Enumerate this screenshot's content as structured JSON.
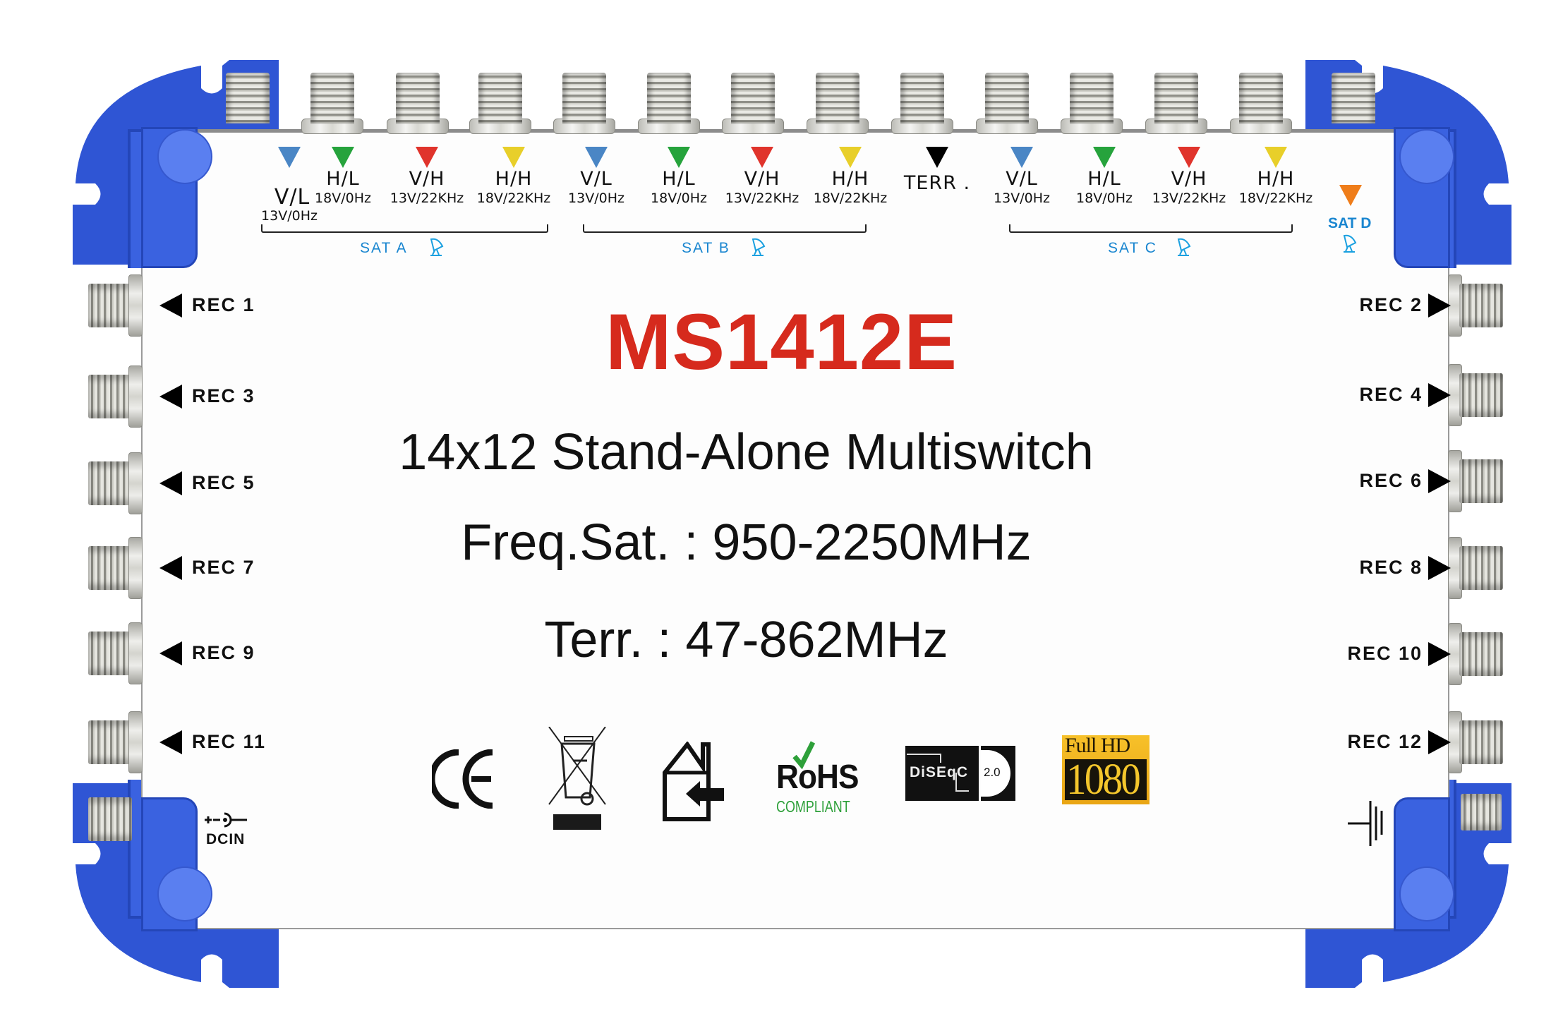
{
  "product": {
    "model": "MS1412E",
    "description": "14x12 Stand-Alone Multiswitch",
    "freq_sat": "Freq.Sat. : 950-2250MHz",
    "freq_terr": "Terr. : 47-862MHz",
    "body_color": "#2f55d4",
    "model_color": "#d62a1d"
  },
  "inputs": [
    {
      "pol": "V/L",
      "volt": "13V/0Hz",
      "color": "#4a86c5"
    },
    {
      "pol": "H/L",
      "volt": "18V/0Hz",
      "color": "#26a33c"
    },
    {
      "pol": "V/H",
      "volt": "13V/22KHz",
      "color": "#e0342c"
    },
    {
      "pol": "H/H",
      "volt": "18V/22KHz",
      "color": "#e8cf2a"
    },
    {
      "pol": "V/L",
      "volt": "13V/0Hz",
      "color": "#4a86c5"
    },
    {
      "pol": "H/L",
      "volt": "18V/0Hz",
      "color": "#26a33c"
    },
    {
      "pol": "V/H",
      "volt": "13V/22KHz",
      "color": "#e0342c"
    },
    {
      "pol": "H/H",
      "volt": "18V/22KHz",
      "color": "#e8cf2a"
    },
    {
      "pol": "TERR .",
      "volt": "",
      "color": "#000000"
    },
    {
      "pol": "V/L",
      "volt": "13V/0Hz",
      "color": "#4a86c5"
    },
    {
      "pol": "H/L",
      "volt": "18V/0Hz",
      "color": "#26a33c"
    },
    {
      "pol": "V/H",
      "volt": "13V/22KHz",
      "color": "#e0342c"
    },
    {
      "pol": "H/H",
      "volt": "18V/22KHz",
      "color": "#e8cf2a"
    }
  ],
  "sat_d": {
    "label": "SAT D",
    "color": "#ef7d1a"
  },
  "sat_groups": [
    {
      "label": "SAT A"
    },
    {
      "label": "SAT B"
    },
    {
      "label": "SAT C"
    }
  ],
  "sat_label_color": "#1a86d0",
  "outputs_left": [
    "REC 1",
    "REC 3",
    "REC 5",
    "REC 7",
    "REC 9",
    "REC 11"
  ],
  "outputs_right": [
    "REC 2",
    "REC 4",
    "REC 6",
    "REC 8",
    "REC 10",
    "REC 12"
  ],
  "power": {
    "label": "DCIN",
    "symbol": "+-○-"
  },
  "certifications": {
    "ce": "CE",
    "weee": "weee-bin-icon",
    "indoor": "indoor-use-icon",
    "rohs_title": "RoHS",
    "rohs_sub": "COMPLIANT",
    "diseqc": "DiSEqC",
    "diseqc_version": "2.0",
    "fullhd_top": "Full HD",
    "fullhd_bottom": "1080"
  }
}
